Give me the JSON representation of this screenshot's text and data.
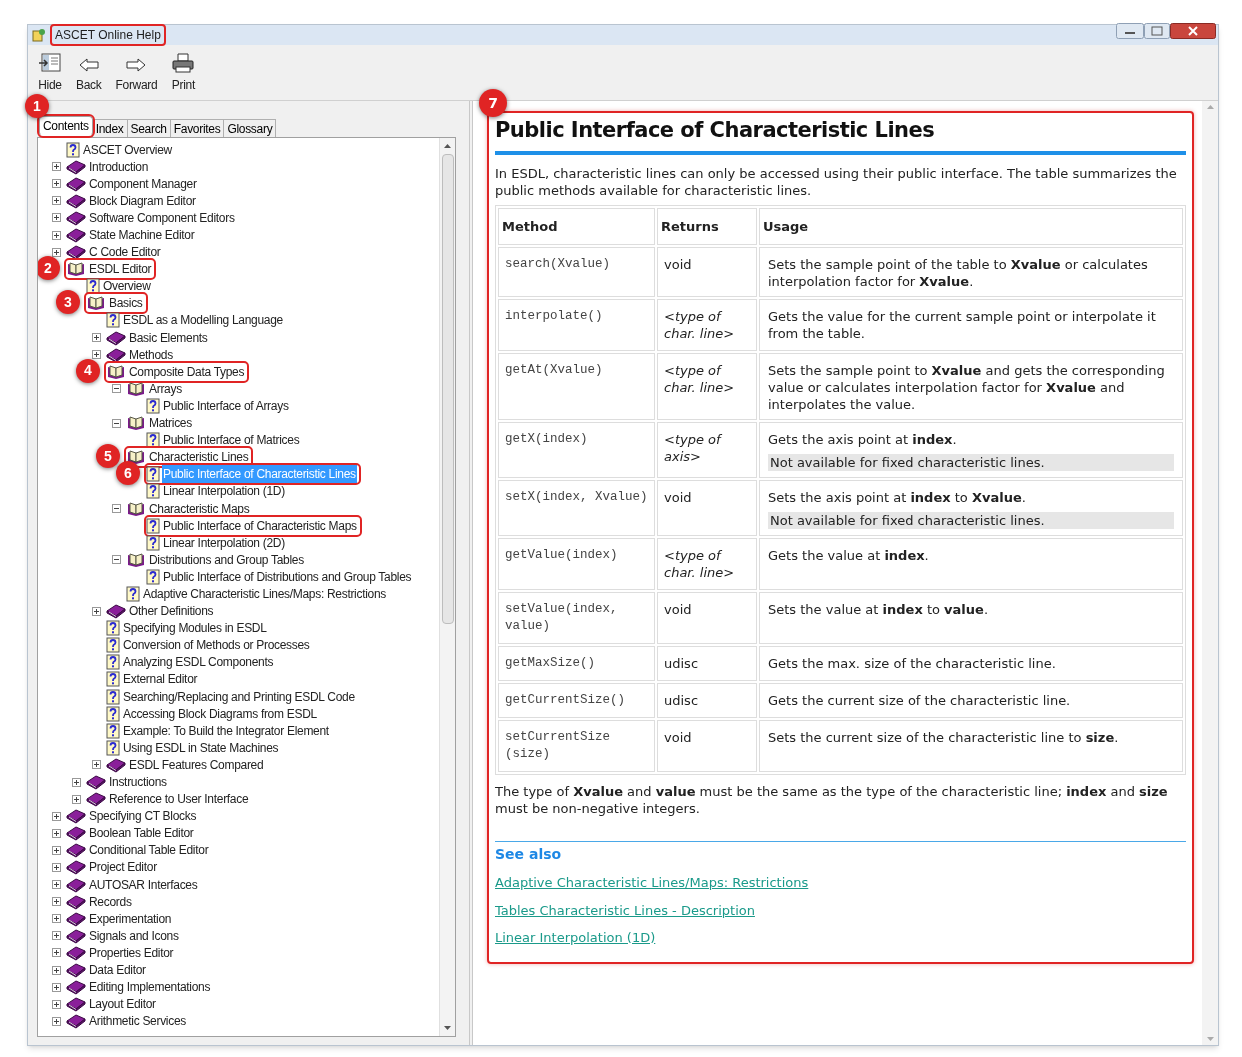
{
  "window": {
    "title": "ASCET Online Help",
    "title_outlined": true
  },
  "toolbar": [
    {
      "label": "Hide",
      "kind": "hide"
    },
    {
      "label": "Back",
      "kind": "back"
    },
    {
      "label": "Forward",
      "kind": "forward"
    },
    {
      "label": "Print",
      "kind": "print"
    }
  ],
  "tabs": [
    {
      "label": "Contents",
      "selected": true,
      "callout": "1"
    },
    {
      "label": "Index",
      "selected": false
    },
    {
      "label": "Search",
      "selected": false
    },
    {
      "label": "Favorites",
      "selected": false
    },
    {
      "label": "Glossary",
      "selected": false
    }
  ],
  "tree": [
    {
      "label": "ASCET Overview",
      "kind": "page",
      "selected": false
    },
    {
      "label": "Introduction",
      "kind": "book",
      "expanded": false,
      "selected": false
    },
    {
      "label": "Component Manager",
      "kind": "book",
      "expanded": false,
      "selected": false
    },
    {
      "label": "Block Diagram Editor",
      "kind": "book",
      "expanded": false,
      "selected": false
    },
    {
      "label": "Software Component Editors",
      "kind": "book",
      "expanded": false,
      "selected": false
    },
    {
      "label": "State Machine Editor",
      "kind": "book",
      "expanded": false,
      "selected": false
    },
    {
      "label": "C Code Editor",
      "kind": "book",
      "expanded": false,
      "selected": false
    },
    {
      "label": "ESDL Editor",
      "kind": "book",
      "expanded": true,
      "selected": false,
      "callout": "2",
      "outlined": true,
      "children": [
        {
          "label": "Overview",
          "kind": "page",
          "selected": false
        },
        {
          "label": "Basics",
          "kind": "book",
          "expanded": true,
          "selected": false,
          "callout": "3",
          "outlined": true,
          "children": [
            {
              "label": "ESDL as a Modelling Language",
              "kind": "page",
              "selected": false
            },
            {
              "label": "Basic Elements",
              "kind": "book",
              "expanded": false,
              "selected": false
            },
            {
              "label": "Methods",
              "kind": "book",
              "expanded": false,
              "selected": false
            },
            {
              "label": "Composite Data Types",
              "kind": "book",
              "expanded": true,
              "selected": false,
              "callout": "4",
              "outlined": true,
              "children": [
                {
                  "label": "Arrays",
                  "kind": "book",
                  "expanded": true,
                  "selected": false,
                  "children": [
                    {
                      "label": "Public Interface of Arrays",
                      "kind": "page",
                      "selected": false
                    }
                  ]
                },
                {
                  "label": "Matrices",
                  "kind": "book",
                  "expanded": true,
                  "selected": false,
                  "children": [
                    {
                      "label": "Public Interface of Matrices",
                      "kind": "page",
                      "selected": false
                    }
                  ]
                },
                {
                  "label": "Characteristic Lines",
                  "kind": "book",
                  "expanded": true,
                  "selected": false,
                  "callout": "5",
                  "outlined": true,
                  "children": [
                    {
                      "label": "Public Interface of Characteristic Lines",
                      "kind": "page",
                      "selected": true,
                      "callout": "6",
                      "outlined": true
                    },
                    {
                      "label": "Linear Interpolation (1D)",
                      "kind": "page",
                      "selected": false
                    }
                  ]
                },
                {
                  "label": "Characteristic Maps",
                  "kind": "book",
                  "expanded": true,
                  "selected": false,
                  "children": [
                    {
                      "label": "Public Interface of Characteristic Maps",
                      "kind": "page",
                      "selected": false,
                      "outlined": true
                    },
                    {
                      "label": "Linear Interpolation (2D)",
                      "kind": "page",
                      "selected": false
                    }
                  ]
                },
                {
                  "label": "Distributions and Group Tables",
                  "kind": "book",
                  "expanded": true,
                  "selected": false,
                  "children": [
                    {
                      "label": "Public Interface of Distributions and Group Tables",
                      "kind": "page",
                      "selected": false
                    }
                  ]
                },
                {
                  "label": "Adaptive Characteristic Lines/Maps: Restrictions",
                  "kind": "page",
                  "selected": false
                }
              ]
            },
            {
              "label": "Other Definitions",
              "kind": "book",
              "expanded": false,
              "selected": false
            },
            {
              "label": "Specifying Modules in ESDL",
              "kind": "page",
              "selected": false
            },
            {
              "label": "Conversion of Methods or Processes",
              "kind": "page",
              "selected": false
            },
            {
              "label": "Analyzing ESDL Components",
              "kind": "page",
              "selected": false
            },
            {
              "label": "External Editor",
              "kind": "page",
              "selected": false
            },
            {
              "label": "Searching/Replacing and Printing ESDL Code",
              "kind": "page",
              "selected": false
            },
            {
              "label": "Accessing Block Diagrams from ESDL",
              "kind": "page",
              "selected": false
            },
            {
              "label": "Example: To Build the Integrator Element",
              "kind": "page",
              "selected": false
            },
            {
              "label": "Using ESDL in State Machines",
              "kind": "page",
              "selected": false
            },
            {
              "label": "ESDL Features Compared",
              "kind": "book",
              "expanded": false,
              "selected": false
            }
          ]
        },
        {
          "label": "Instructions",
          "kind": "book",
          "expanded": false,
          "selected": false
        },
        {
          "label": "Reference to User Interface",
          "kind": "book",
          "expanded": false,
          "selected": false
        }
      ]
    },
    {
      "label": "Specifying CT Blocks",
      "kind": "book",
      "expanded": false,
      "selected": false
    },
    {
      "label": "Boolean Table Editor",
      "kind": "book",
      "expanded": false,
      "selected": false
    },
    {
      "label": "Conditional Table Editor",
      "kind": "book",
      "expanded": false,
      "selected": false
    },
    {
      "label": "Project Editor",
      "kind": "book",
      "expanded": false,
      "selected": false
    },
    {
      "label": "AUTOSAR Interfaces",
      "kind": "book",
      "expanded": false,
      "selected": false
    },
    {
      "label": "Records",
      "kind": "book",
      "expanded": false,
      "selected": false
    },
    {
      "label": "Experimentation",
      "kind": "book",
      "expanded": false,
      "selected": false
    },
    {
      "label": "Signals and Icons",
      "kind": "book",
      "expanded": false,
      "selected": false
    },
    {
      "label": "Properties Editor",
      "kind": "book",
      "expanded": false,
      "selected": false
    },
    {
      "label": "Data Editor",
      "kind": "book",
      "expanded": false,
      "selected": false
    },
    {
      "label": "Editing Implementations",
      "kind": "book",
      "expanded": false,
      "selected": false
    },
    {
      "label": "Layout Editor",
      "kind": "book",
      "expanded": false,
      "selected": false
    },
    {
      "label": "Arithmetic Services",
      "kind": "book",
      "expanded": false,
      "selected": false
    }
  ],
  "content": {
    "callout": "7",
    "outlined": true,
    "title": "Public Interface of Characteristic Lines",
    "intro": "In ESDL, characteristic lines can only be accessed using their public interface. The table summarizes the public methods available for characteristic lines.",
    "table": {
      "columns": [
        "Method",
        "Returns",
        "Usage"
      ],
      "rows": [
        {
          "method": "search(Xvalue)",
          "returns": "void",
          "returns_is_type": false,
          "usage": "Sets the sample point of the table to **Xvalue** or calculates interpolation factor for **Xvalue**."
        },
        {
          "method": "interpolate()",
          "returns": "<type of char. line>",
          "returns_is_type": true,
          "usage": "Gets the value for the current sample point or interpolate it from the table."
        },
        {
          "method": "getAt(Xvalue)",
          "returns": "<type of char. line>",
          "returns_is_type": true,
          "usage": "Sets the sample point to **Xvalue** and gets the corresponding value or calculates interpolation factor for **Xvalue** and interpolates the value."
        },
        {
          "method": "getX(index)",
          "returns": "<type of axis>",
          "returns_is_type": true,
          "usage": "Gets the axis point at **index**.",
          "note": "Not available for fixed characteristic lines."
        },
        {
          "method": "setX(index, Xvalue)",
          "returns": "void",
          "returns_is_type": false,
          "usage": "Sets the axis point at **index** to **Xvalue**.",
          "note": "Not available for fixed characteristic lines."
        },
        {
          "method": "getValue(index)",
          "returns": "<type of char. line>",
          "returns_is_type": true,
          "usage": "Gets the value at **index**."
        },
        {
          "method": "setValue(index, value)",
          "returns": "void",
          "returns_is_type": false,
          "usage": "Sets the value at **index** to **value**."
        },
        {
          "method": "getMaxSize()",
          "returns": "udisc",
          "returns_is_type": false,
          "usage": "Gets the max. size of the characteristic line."
        },
        {
          "method": "getCurrentSize()",
          "returns": "udisc",
          "returns_is_type": false,
          "usage": "Gets the current size of the characteristic line."
        },
        {
          "method": "setCurrentSize (size)",
          "returns": "void",
          "returns_is_type": false,
          "usage": "Sets the current size of the characteristic line to **size**."
        }
      ]
    },
    "footnote": "The type of **Xvalue** and **value** must be the same as the type of the characteristic line; **index** and **size** must be non-negative integers.",
    "see_also": {
      "heading": "See also",
      "links": [
        "Adaptive Characteristic Lines/Maps: Restrictions",
        "Tables Characteristic Lines - Description",
        "Linear Interpolation (1D)"
      ]
    }
  }
}
